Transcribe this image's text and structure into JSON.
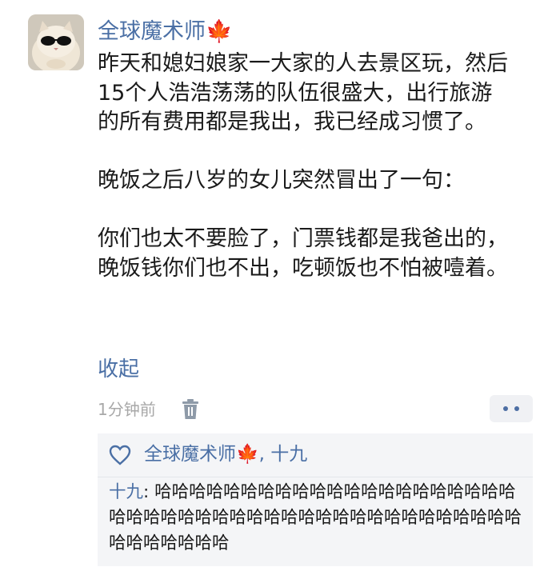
{
  "post": {
    "username": "全球魔术师🍁",
    "paragraphs": [
      "昨天和媳妇娘家一大家的人去景区玩，然后15个人浩浩荡荡的队伍很盛大，出行旅游的所有费用都是我出，我已经成习惯了。",
      "晚饭之后八岁的女儿突然冒出了一句：",
      "你们也太不要脸了，门票钱都是我爸出的，晚饭钱你们也不出，吃顿饭也不怕被噎着。"
    ],
    "collapse_label": "收起",
    "timestamp": "1分钟前"
  },
  "reply": {
    "likes_text": "全球魔术师🍁, 十九",
    "comment_author": "十九",
    "comment_separator": ": ",
    "comment_text": "哈哈哈哈哈哈哈哈哈哈哈哈哈哈哈哈哈哈哈哈哈哈哈哈哈哈哈哈哈哈哈哈哈哈哈哈哈哈哈哈哈哈哈哈哈哈哈哈哈哈哈哈"
  },
  "icons": {
    "delete": "trash-icon",
    "more": "more-dots-icon",
    "like": "heart-icon"
  },
  "colors": {
    "link_blue": "#4a6fa5",
    "meta_gray": "#a8a8a8",
    "reply_bg": "#f4f5f7"
  }
}
